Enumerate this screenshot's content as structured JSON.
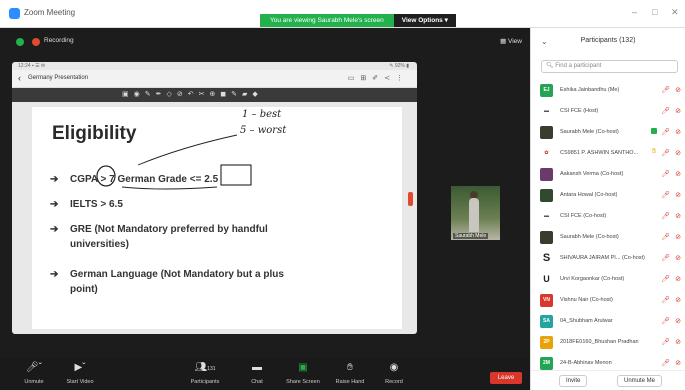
{
  "window": {
    "title": "Zoom Meeting",
    "viewing_text": "You are viewing Saurabh Mele's screen",
    "view_options": "View Options ▾"
  },
  "meeting": {
    "recording_label": "Recording",
    "view_label": "View"
  },
  "shared_screen": {
    "status_left": "12:24 ▪ ☰ ✉",
    "status_right": "✎ 92% ▮",
    "doc_title": "Germany Presentation",
    "slide": {
      "title": "Eligibility",
      "bullets": [
        {
          "text": "CGPA > 7 German Grade <= 2.5"
        },
        {
          "text": "IELTS > 6.5"
        },
        {
          "text": "GRE (Not Mandatory preferred by handful",
          "text2": "universities)"
        },
        {
          "text": "German Language (Not Mandatory but a plus",
          "text2": "point)"
        }
      ],
      "handwriting": {
        "line1": "1 – best",
        "line2": "5 – worst"
      }
    }
  },
  "self_video": {
    "name": "Saurabh Mele"
  },
  "controls": [
    {
      "label": "Unmute",
      "icon": "microphone-muted-icon"
    },
    {
      "label": "Start Video",
      "icon": "video-off-icon"
    },
    {
      "label": "Participants",
      "icon": "participants-icon",
      "count": "131"
    },
    {
      "label": "Chat",
      "icon": "chat-icon"
    },
    {
      "label": "Share Screen",
      "icon": "share-screen-icon"
    },
    {
      "label": "Raise Hand",
      "icon": "raise-hand-icon"
    },
    {
      "label": "Record",
      "icon": "record-icon"
    }
  ],
  "leave_label": "Leave",
  "participants": {
    "title": "Participants (132)",
    "search_placeholder": "Find a participant",
    "items": [
      {
        "initials": "EJ",
        "color": "#23a455",
        "name": "Eshika Jainbandhu (Me)"
      },
      {
        "initials": "",
        "color": "#ffffff",
        "name": "CSI FCE (Host)"
      },
      {
        "initials": "",
        "color": "#3b3b2f",
        "name": "Saurabh Mele (Co-host)"
      },
      {
        "initials": "",
        "color": "#ffffff",
        "name": "CS9851 P. ASHWIN SANTHO..."
      },
      {
        "initials": "",
        "color": "#6b3a6b",
        "name": "Aakansh Verma (Co-host)"
      },
      {
        "initials": "",
        "color": "#2f4a2f",
        "name": "Antara Howal (Co-host)"
      },
      {
        "initials": "",
        "color": "#ffffff",
        "name": "CSI FCE (Co-host)"
      },
      {
        "initials": "",
        "color": "#3b3b2f",
        "name": "Saurabh Mele (Co-host)"
      },
      {
        "initials": "S",
        "color": "#ffffff",
        "name": "SHIVAURA JAIRAM PI... (Co-host)"
      },
      {
        "initials": "U",
        "color": "#ffffff",
        "name": "Urvi Korgaonkar (Co-host)"
      },
      {
        "initials": "VN",
        "color": "#d9362c",
        "name": "Vishnu Nair (Co-host)"
      },
      {
        "initials": "SA",
        "color": "#23a4a0",
        "name": "04_Shubham Arulwar"
      },
      {
        "initials": "2P",
        "color": "#e8a20b",
        "name": "2018FE0160_Bhushan Pradhan"
      },
      {
        "initials": "2M",
        "color": "#23a455",
        "name": "24-B-Abhinav Menon"
      }
    ],
    "invite_label": "Invite",
    "unmute_me_label": "Unmute Me"
  }
}
